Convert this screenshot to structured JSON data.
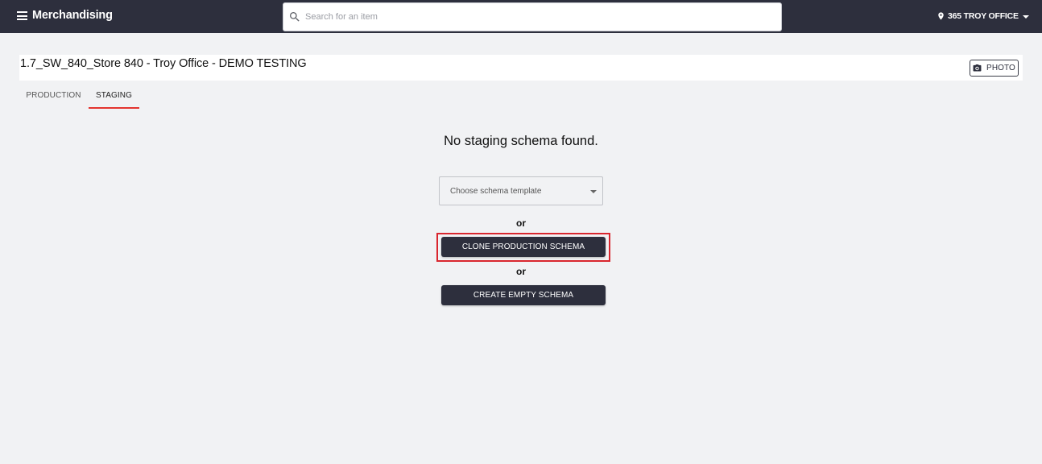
{
  "appbar": {
    "title": "Merchandising",
    "search_placeholder": "Search for an item",
    "location": "365 TROY OFFICE"
  },
  "page": {
    "title": "1.7_SW_840_Store 840 - Troy Office - DEMO TESTING",
    "photo_label": "PHOTO"
  },
  "tabs": [
    {
      "label": "PRODUCTION",
      "active": false
    },
    {
      "label": "STAGING",
      "active": true
    }
  ],
  "staging": {
    "empty_message": "No staging schema found.",
    "template_select_placeholder": "Choose schema template",
    "or_text": "or",
    "clone_label": "CLONE PRODUCTION SCHEMA",
    "create_label": "CREATE EMPTY SCHEMA"
  },
  "colors": {
    "appbar_bg": "#2d2f3d",
    "active_tab_underline": "#e3342f",
    "highlight": "#d9262e",
    "page_bg": "#f1f2f4"
  },
  "icons": [
    "menu-icon",
    "search-icon",
    "map-pin-icon",
    "chevron-down-icon",
    "camera-icon"
  ]
}
